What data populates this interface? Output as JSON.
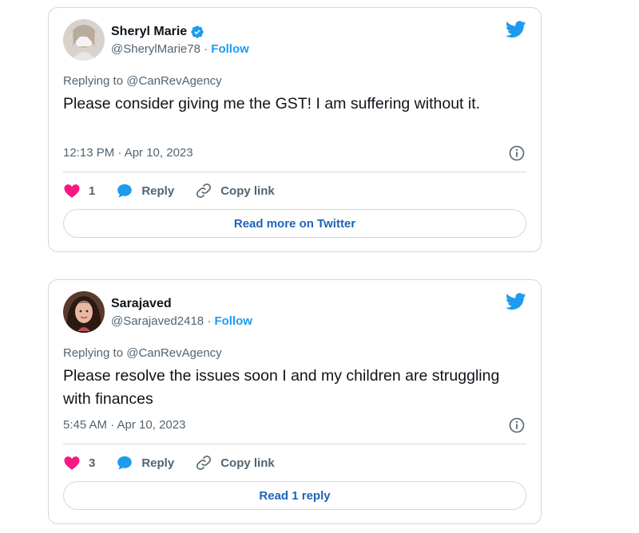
{
  "tweets": [
    {
      "author_name": "Sheryl Marie",
      "verified": true,
      "handle": "@SherylMarie78",
      "separator": "·",
      "follow_label": "Follow",
      "replying_to_label": "Replying to",
      "replying_to_handle": "@CanRevAgency",
      "text": "Please consider giving me the GST! I am suffering without it.",
      "timestamp": "12:13 PM · Apr 10, 2023",
      "like_count": "1",
      "reply_label": "Reply",
      "copy_link_label": "Copy link",
      "footer_button_label": "Read more on Twitter",
      "avatar_icon": "avatar-masked-woman"
    },
    {
      "author_name": "Sarajaved",
      "verified": false,
      "handle": "@Sarajaved2418",
      "separator": "·",
      "follow_label": "Follow",
      "replying_to_label": "Replying to",
      "replying_to_handle": "@CanRevAgency",
      "text": "Please resolve the issues soon I and my children are struggling with finances",
      "timestamp": "5:45 AM · Apr 10, 2023",
      "like_count": "3",
      "reply_label": "Reply",
      "copy_link_label": "Copy link",
      "footer_button_label": "Read 1 reply",
      "avatar_icon": "avatar-woman-dark-hair"
    }
  ],
  "colors": {
    "accent_blue": "#1d9bf0",
    "link_blue": "#1d64b8",
    "like_pink": "#f91880",
    "muted_text": "#536471",
    "border": "#cfd9de"
  }
}
